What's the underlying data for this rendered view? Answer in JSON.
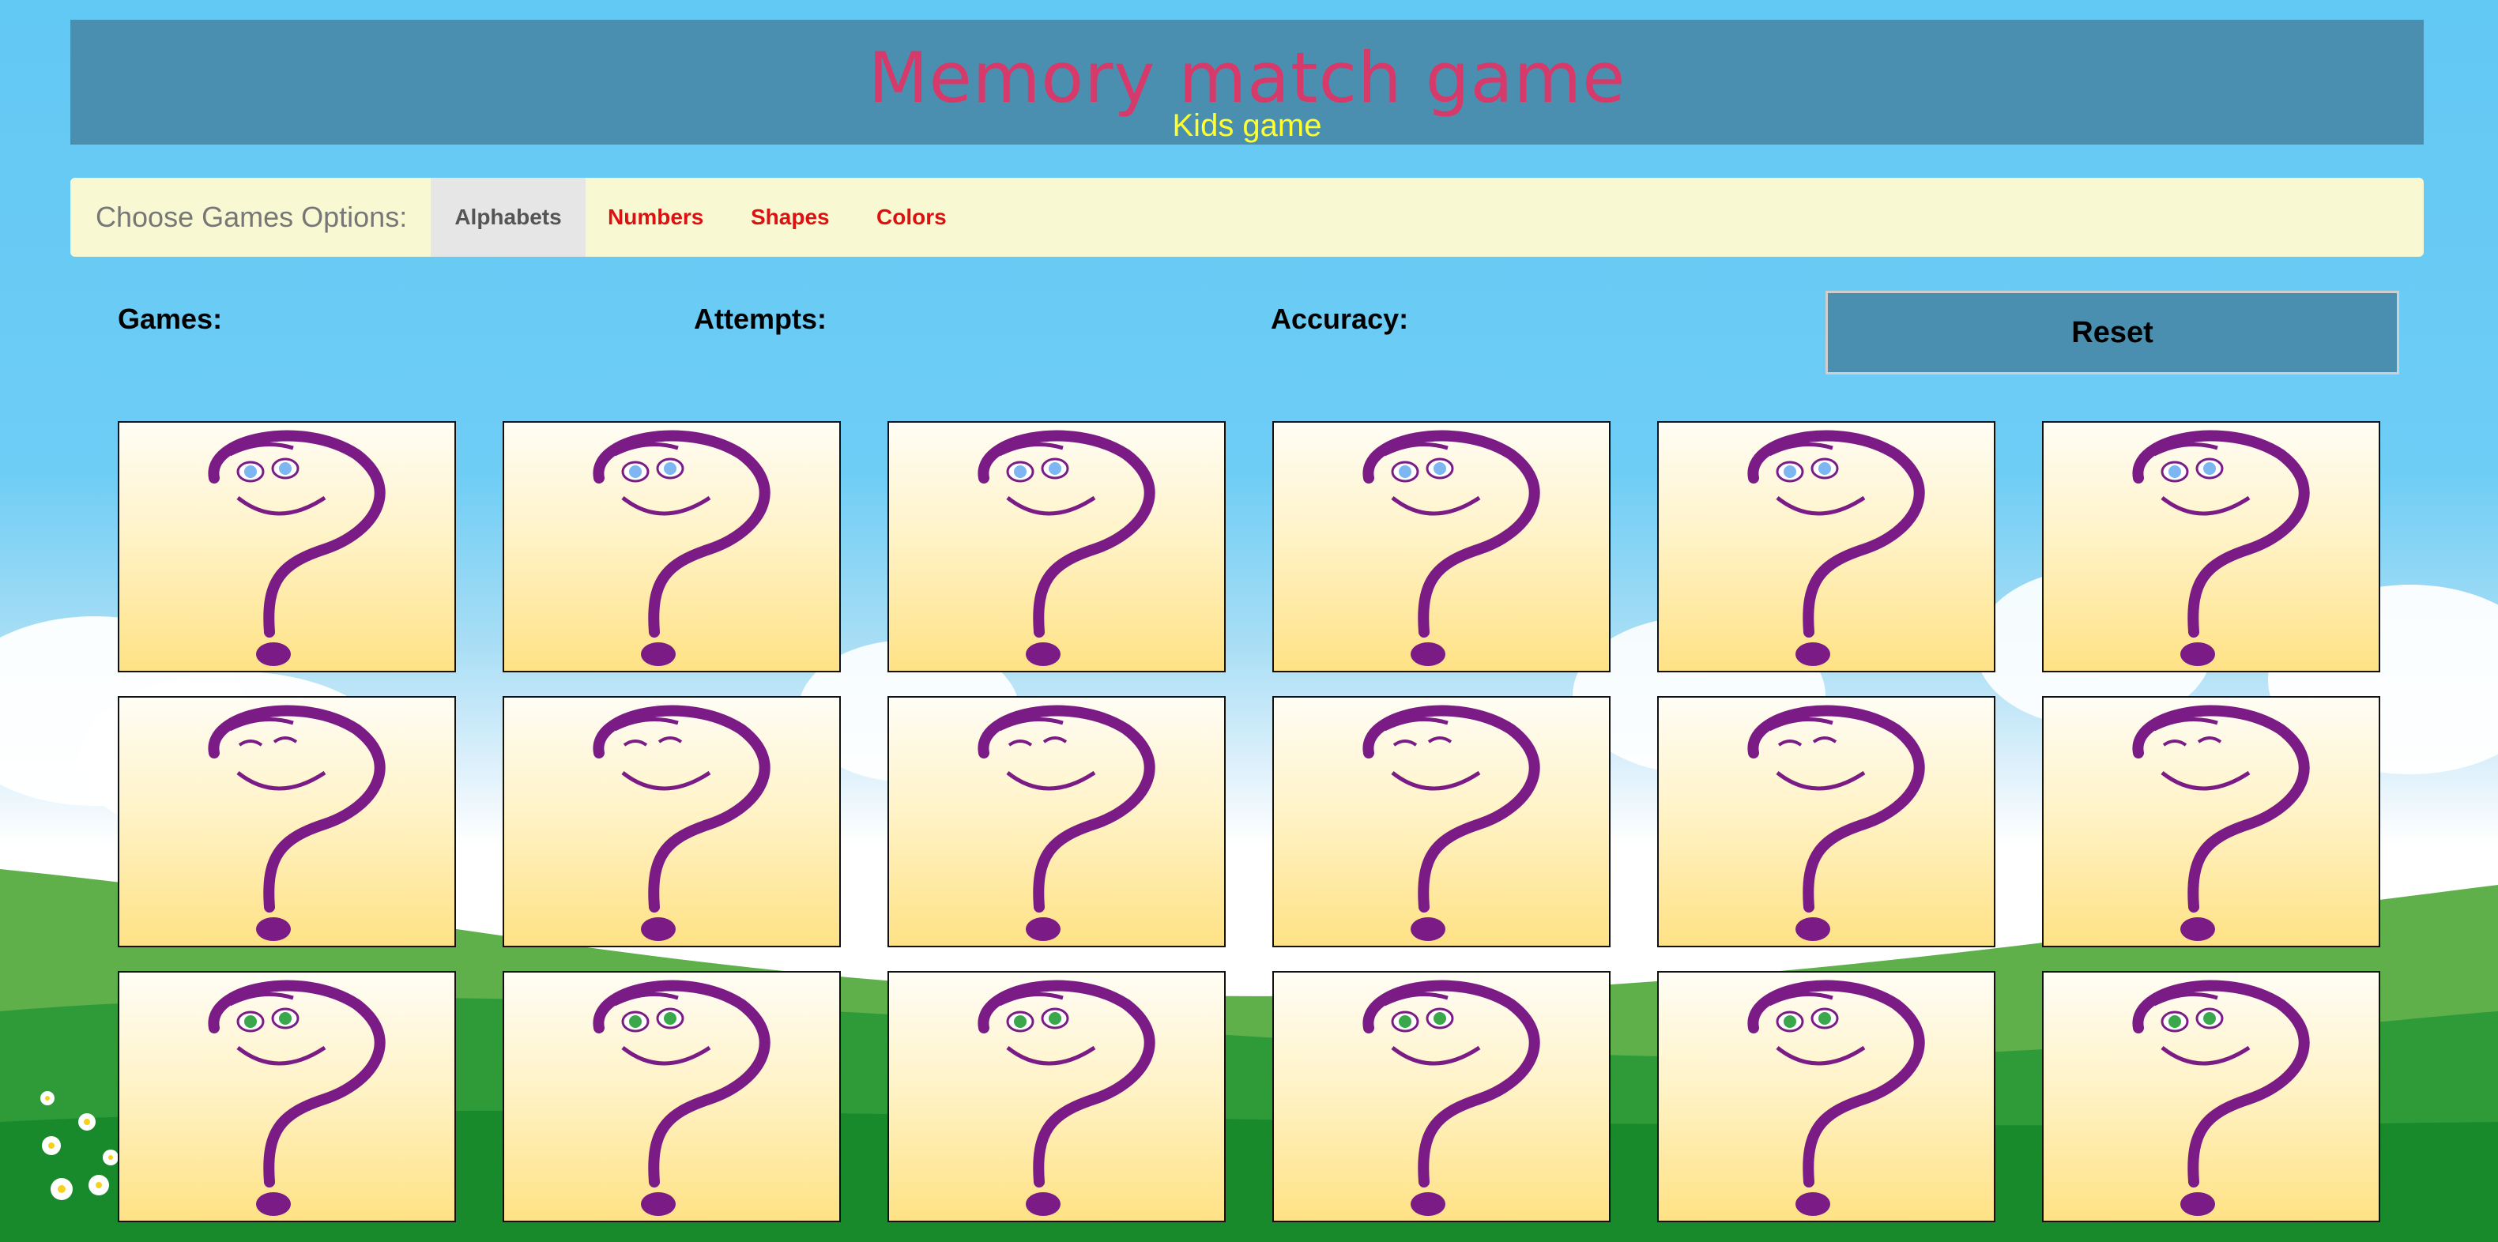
{
  "header": {
    "title": "Memory match game",
    "subtitle": "Kids game"
  },
  "options": {
    "label": "Choose Games Options:",
    "tabs": [
      "Alphabets",
      "Numbers",
      "Shapes",
      "Colors"
    ],
    "active_tab": "Alphabets"
  },
  "stats": {
    "games_label": "Games:",
    "attempts_label": "Attempts:",
    "accuracy_label": "Accuracy:"
  },
  "reset_label": "Reset",
  "grid": {
    "rows": 3,
    "cols": 6,
    "card_face": "question-mark-face",
    "row_eye_styles": [
      "blue-eyes",
      "closed-eyes",
      "green-eyes"
    ]
  },
  "colors": {
    "header_bg": "#4a8fb0",
    "title": "#d63a6a",
    "subtitle": "#ffff2e",
    "options_bg": "#f8f9d2",
    "tab_text": "#dd1111",
    "question_mark": "#7a1b86"
  }
}
